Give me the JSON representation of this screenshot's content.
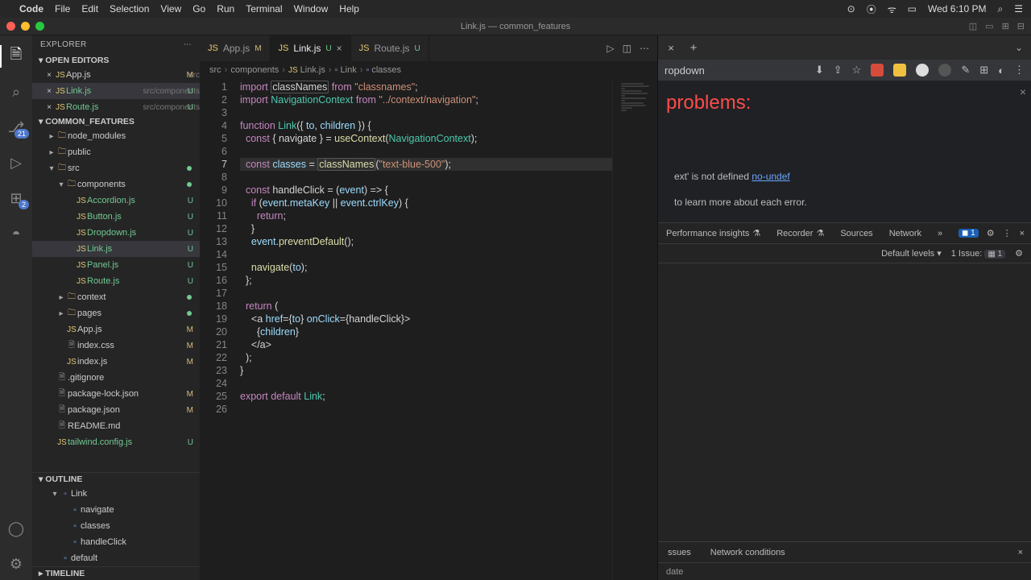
{
  "mac_menu": {
    "app": "Code",
    "items": [
      "File",
      "Edit",
      "Selection",
      "View",
      "Go",
      "Run",
      "Terminal",
      "Window",
      "Help"
    ],
    "clock": "Wed 6:10 PM"
  },
  "window_title": "Link.js — common_features",
  "activity_bar": {
    "icons": [
      "files",
      "search",
      "git",
      "debug",
      "extensions",
      "docker"
    ],
    "badges": {
      "git": "21",
      "extensions": "2"
    }
  },
  "explorer": {
    "title": "EXPLORER",
    "open_editors_label": "OPEN EDITORS",
    "open_editors": [
      {
        "name": "App.js",
        "path": "src",
        "status": "M"
      },
      {
        "name": "Link.js",
        "path": "src/components",
        "status": "U",
        "active": true
      },
      {
        "name": "Route.js",
        "path": "src/components",
        "status": "U"
      }
    ],
    "project_label": "COMMON_FEATURES",
    "tree": [
      {
        "t": "folder",
        "name": "node_modules",
        "depth": 0,
        "open": false
      },
      {
        "t": "folder",
        "name": "public",
        "depth": 0,
        "open": false
      },
      {
        "t": "folder",
        "name": "src",
        "depth": 0,
        "open": true,
        "udot": true
      },
      {
        "t": "folder",
        "name": "components",
        "depth": 1,
        "open": true,
        "udot": true
      },
      {
        "t": "file",
        "name": "Accordion.js",
        "depth": 2,
        "status": "U"
      },
      {
        "t": "file",
        "name": "Button.js",
        "depth": 2,
        "status": "U"
      },
      {
        "t": "file",
        "name": "Dropdown.js",
        "depth": 2,
        "status": "U"
      },
      {
        "t": "file",
        "name": "Link.js",
        "depth": 2,
        "status": "U",
        "sel": true
      },
      {
        "t": "file",
        "name": "Panel.js",
        "depth": 2,
        "status": "U"
      },
      {
        "t": "file",
        "name": "Route.js",
        "depth": 2,
        "status": "U"
      },
      {
        "t": "folder",
        "name": "context",
        "depth": 1,
        "open": false,
        "udot": true
      },
      {
        "t": "folder",
        "name": "pages",
        "depth": 1,
        "open": false,
        "udot": true
      },
      {
        "t": "file",
        "name": "App.js",
        "depth": 1,
        "status": "M"
      },
      {
        "t": "file",
        "name": "index.css",
        "depth": 1,
        "status": "M"
      },
      {
        "t": "file",
        "name": "index.js",
        "depth": 1,
        "status": "M"
      },
      {
        "t": "file",
        "name": ".gitignore",
        "depth": 0
      },
      {
        "t": "file",
        "name": "package-lock.json",
        "depth": 0,
        "status": "M"
      },
      {
        "t": "file",
        "name": "package.json",
        "depth": 0,
        "status": "M"
      },
      {
        "t": "file",
        "name": "README.md",
        "depth": 0
      },
      {
        "t": "file",
        "name": "tailwind.config.js",
        "depth": 0,
        "status": "U"
      }
    ],
    "outline_label": "OUTLINE",
    "outline": [
      {
        "name": "Link",
        "kind": "fn",
        "depth": 0
      },
      {
        "name": "navigate",
        "kind": "var",
        "depth": 1
      },
      {
        "name": "classes",
        "kind": "var",
        "depth": 1
      },
      {
        "name": "handleClick",
        "kind": "var",
        "depth": 1
      },
      {
        "name": "default",
        "kind": "mod",
        "depth": 0
      }
    ],
    "timeline_label": "TIMELINE"
  },
  "tabs": [
    {
      "name": "App.js",
      "status": "M"
    },
    {
      "name": "Link.js",
      "status": "U",
      "active": true
    },
    {
      "name": "Route.js",
      "status": "U"
    }
  ],
  "breadcrumbs": [
    "src",
    "components",
    "Link.js",
    "Link",
    "classes"
  ],
  "code": {
    "lines": [
      "import classNames from \"classnames\";",
      "import NavigationContext from \"../context/navigation\";",
      "",
      "function Link({ to, children }) {",
      "  const { navigate } = useContext(NavigationContext);",
      "",
      "  const classes = classNames(\"text-blue-500\");",
      "",
      "  const handleClick = (event) => {",
      "    if (event.metaKey || event.ctrlKey) {",
      "      return;",
      "    }",
      "    event.preventDefault();",
      "",
      "    navigate(to);",
      "  };",
      "",
      "  return (",
      "    <a href={to} onClick={handleClick}>",
      "      {children}",
      "    </a>",
      "  );",
      "}",
      "",
      "export default Link;",
      ""
    ],
    "active_line": 7
  },
  "browser": {
    "addr_tail": "ropdown",
    "page_heading": "problems:",
    "error_line": "ext' is not defined  ",
    "error_rule": "no-undef",
    "error_hint": " to learn more about each error.",
    "devtools_tabs": [
      "Performance insights",
      "Recorder",
      "Sources",
      "Network"
    ],
    "devtools_more": "»",
    "errors_pill": "1",
    "filter_levels": "Default levels ▾",
    "issues_label": "1 Issue:",
    "issues_count": "1",
    "bottom_tabs": [
      "ssues",
      "Network conditions"
    ],
    "footer": "date"
  }
}
